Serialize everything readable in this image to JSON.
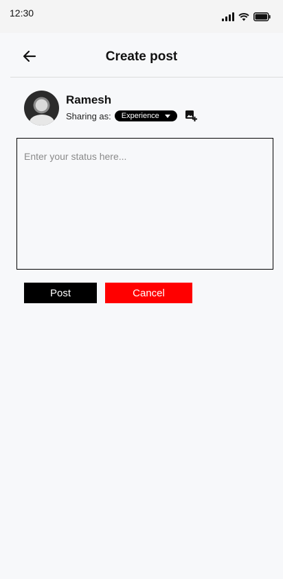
{
  "status_bar": {
    "time": "12:30"
  },
  "header": {
    "title": "Create post"
  },
  "author": {
    "name": "Ramesh",
    "sharing_label": "Sharing as:",
    "sharing_value": "Experience"
  },
  "composer": {
    "placeholder": "Enter your status here...",
    "value": ""
  },
  "actions": {
    "post_label": "Post",
    "cancel_label": "Cancel"
  },
  "colors": {
    "cancel": "#ff0000",
    "post": "#000000",
    "background": "#f7f8fa"
  },
  "icons": {
    "back": "arrow-left-icon",
    "add_image": "add-image-icon",
    "signal": "signal-icon",
    "wifi": "wifi-icon",
    "battery": "battery-icon",
    "dropdown": "caret-down-icon"
  }
}
